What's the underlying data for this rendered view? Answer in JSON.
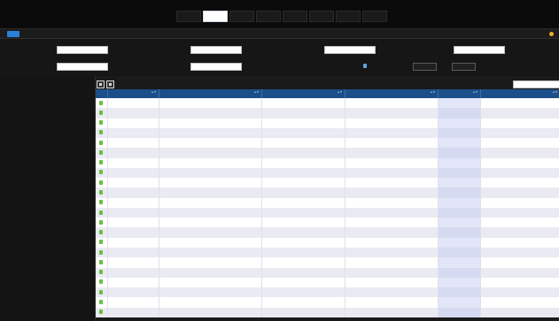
{
  "app": {
    "title": ""
  },
  "header": {
    "tabs": [
      {
        "label": "",
        "active": false
      },
      {
        "label": "",
        "active": true
      },
      {
        "label": "",
        "active": false
      },
      {
        "label": "",
        "active": false
      },
      {
        "label": "",
        "active": false
      },
      {
        "label": "",
        "active": false
      },
      {
        "label": "",
        "active": false
      },
      {
        "label": "",
        "active": false
      }
    ]
  },
  "toolbar": {
    "primary_label": "",
    "logout_label": ""
  },
  "search": {
    "patient_id_label": "",
    "patient_id_value": "",
    "patient_name_label": "",
    "patient_name_value": "",
    "study_date_from_label": "",
    "study_date_from_value": "",
    "study_date_to_label": "",
    "study_date_to_value": "",
    "study_description_label": "",
    "study_description_value": "",
    "referring_physician_label": "",
    "referring_physician_value": "",
    "modality_label": "",
    "modality_value": "",
    "search_label": "",
    "reset_label": ""
  },
  "grid": {
    "filter_label": "",
    "columns": [
      "",
      "",
      "",
      "",
      "",
      "",
      ""
    ],
    "rows": [
      {
        "patient_id": "",
        "patient_name": "",
        "study_date": "",
        "description": "",
        "modality": "",
        "images": ""
      },
      {
        "patient_id": "",
        "patient_name": "",
        "study_date": "",
        "description": "",
        "modality": "",
        "images": ""
      },
      {
        "patient_id": "",
        "patient_name": "",
        "study_date": "",
        "description": "",
        "modality": "",
        "images": ""
      },
      {
        "patient_id": "",
        "patient_name": "",
        "study_date": "",
        "description": "",
        "modality": "",
        "images": ""
      },
      {
        "patient_id": "",
        "patient_name": "",
        "study_date": "",
        "description": "",
        "modality": "",
        "images": ""
      },
      {
        "patient_id": "",
        "patient_name": "",
        "study_date": "",
        "description": "",
        "modality": "",
        "images": ""
      },
      {
        "patient_id": "",
        "patient_name": "",
        "study_date": "",
        "description": "",
        "modality": "",
        "images": ""
      },
      {
        "patient_id": "",
        "patient_name": "",
        "study_date": "",
        "description": "",
        "modality": "",
        "images": ""
      },
      {
        "patient_id": "",
        "patient_name": "",
        "study_date": "",
        "description": "",
        "modality": "",
        "images": ""
      },
      {
        "patient_id": "",
        "patient_name": "",
        "study_date": "",
        "description": "",
        "modality": "",
        "images": ""
      },
      {
        "patient_id": "",
        "patient_name": "",
        "study_date": "",
        "description": "",
        "modality": "",
        "images": ""
      },
      {
        "patient_id": "",
        "patient_name": "",
        "study_date": "",
        "description": "",
        "modality": "",
        "images": ""
      },
      {
        "patient_id": "",
        "patient_name": "",
        "study_date": "",
        "description": "",
        "modality": "",
        "images": ""
      },
      {
        "patient_id": "",
        "patient_name": "",
        "study_date": "",
        "description": "",
        "modality": "",
        "images": ""
      },
      {
        "patient_id": "",
        "patient_name": "",
        "study_date": "",
        "description": "",
        "modality": "",
        "images": ""
      },
      {
        "patient_id": "",
        "patient_name": "",
        "study_date": "",
        "description": "",
        "modality": "",
        "images": ""
      },
      {
        "patient_id": "",
        "patient_name": "",
        "study_date": "",
        "description": "",
        "modality": "",
        "images": ""
      },
      {
        "patient_id": "",
        "patient_name": "",
        "study_date": "",
        "description": "",
        "modality": "",
        "images": ""
      },
      {
        "patient_id": "",
        "patient_name": "",
        "study_date": "",
        "description": "",
        "modality": "",
        "images": ""
      },
      {
        "patient_id": "",
        "patient_name": "",
        "study_date": "",
        "description": "",
        "modality": "",
        "images": ""
      },
      {
        "patient_id": "",
        "patient_name": "",
        "study_date": "",
        "description": "",
        "modality": "",
        "images": ""
      },
      {
        "patient_id": "",
        "patient_name": "",
        "study_date": "",
        "description": "",
        "modality": "",
        "images": ""
      }
    ]
  },
  "icons": {
    "study_row": "study-status-icon",
    "tool_1": "grid-tool-icon",
    "tool_2": "grid-tool-icon",
    "modality_pick": "modality-picker-icon",
    "logout": "logout-icon"
  },
  "colors": {
    "accent": "#f0a830",
    "brand": "#f0a830",
    "header_row": "#1a4f8a",
    "active_tab": "#ffffff",
    "status_icon": "#6abf3d",
    "button_blue": "#2b7fd6"
  }
}
